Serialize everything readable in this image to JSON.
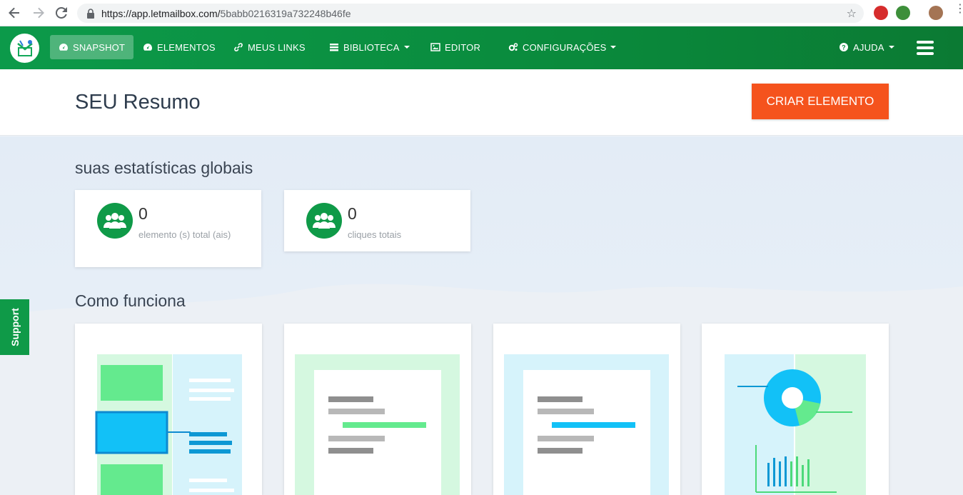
{
  "browser": {
    "url_host": "https://app.letmailbox.com/",
    "url_path": "5babb0216319a732248b46fe"
  },
  "navbar": {
    "items": [
      {
        "label": "SNAPSHOT",
        "icon": "dashboard-icon",
        "active": true
      },
      {
        "label": "ELEMENTOS",
        "icon": "dashboard-icon"
      },
      {
        "label": "MEUS LINKS",
        "icon": "link-icon"
      },
      {
        "label": "BIBLIOTECA",
        "icon": "list-icon",
        "dropdown": true
      },
      {
        "label": "EDITOR",
        "icon": "image-icon"
      },
      {
        "label": "CONFIGURAÇÕES",
        "icon": "gears-icon",
        "dropdown": true
      }
    ],
    "help_label": "AJUDA"
  },
  "header": {
    "title": "SEU Resumo",
    "cta_label": "CRIAR ELEMENTO"
  },
  "stats": {
    "section_title": "suas estatísticas globais",
    "cards": [
      {
        "value": "0",
        "label": "elemento (s) total (ais)"
      },
      {
        "value": "0",
        "label": "cliques totais"
      }
    ]
  },
  "how": {
    "section_title": "Como funciona"
  },
  "support": {
    "label": "Support"
  },
  "colors": {
    "brand_green": "#0f9a48",
    "cta_orange": "#f5531d",
    "accent_blue": "#12c1f7",
    "light_green": "#64ea8e"
  }
}
